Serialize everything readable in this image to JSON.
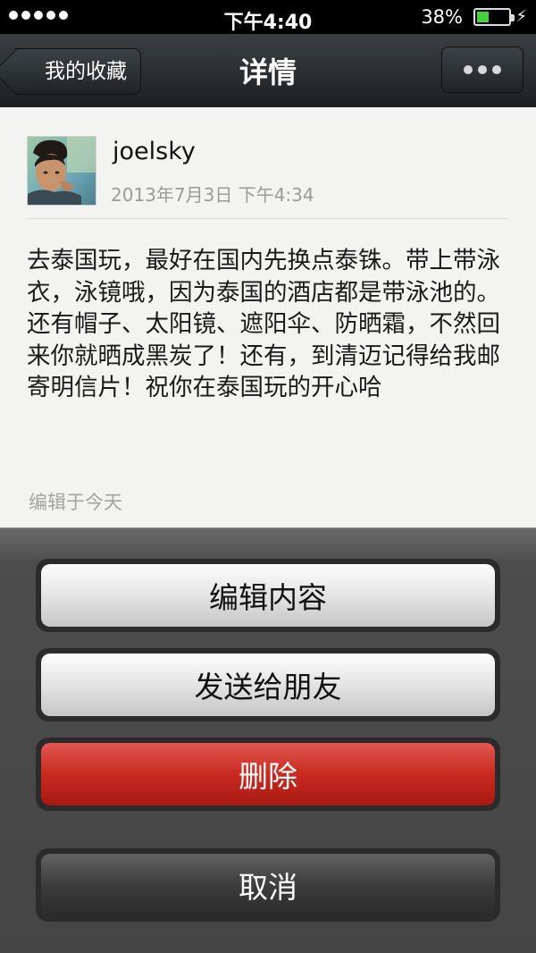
{
  "status_bar": {
    "time": "下午4:40",
    "battery_percent": "38%",
    "battery_level": 0.38
  },
  "nav": {
    "back_label": "我的收藏",
    "title": "详情"
  },
  "post": {
    "username": "joelsky",
    "timestamp": "2013年7月3日 下午4:34",
    "text": "去泰国玩，最好在国内先换点泰铢。带上带泳衣，泳镜哦，因为泰国的酒店都是带泳池的。还有帽子、太阳镜、遮阳伞、防晒霜，不然回来你就晒成黑炭了！还有，到清迈记得给我邮寄明信片！祝你在泰国玩的开心哈",
    "edited_note": "编辑于今天"
  },
  "action_sheet": {
    "edit_label": "编辑内容",
    "send_label": "发送给朋友",
    "delete_label": "删除",
    "cancel_label": "取消"
  },
  "icons": {
    "back": "chevron-left-icon",
    "more": "more-dots-icon",
    "battery": "battery-icon",
    "signal": "signal-dots-icon",
    "charging": "lightning-icon"
  },
  "colors": {
    "battery_fill": "#46d23c",
    "delete_button": "#c82a20",
    "nav_bar": "#2a2f33"
  }
}
